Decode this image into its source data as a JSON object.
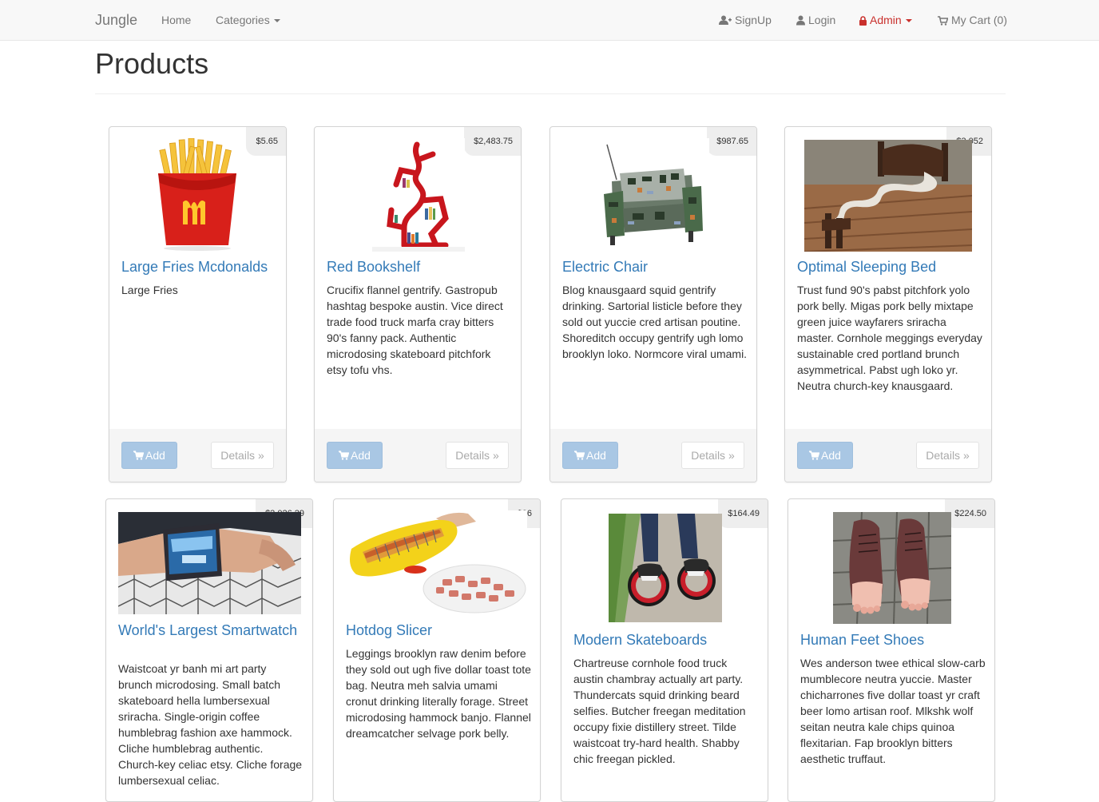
{
  "navbar": {
    "brand": "Jungle",
    "home": "Home",
    "categories": "Categories",
    "signup": "SignUp",
    "login": "Login",
    "admin": "Admin",
    "cart": "My Cart (0)"
  },
  "page": {
    "title": "Products"
  },
  "buttons": {
    "add": "Add",
    "details": "Details »"
  },
  "colors": {
    "link": "#337ab7",
    "admin": "#c9302c",
    "add_button": "#a9c7e4"
  },
  "products": [
    {
      "name": "Large Fries Mcdonalds",
      "price": "$5.65",
      "description": "Large Fries",
      "image": "fries"
    },
    {
      "name": "Red Bookshelf",
      "price": "$2,483.75",
      "description": "Crucifix flannel gentrify. Gastropub hashtag bespoke austin. Vice direct trade food truck marfa cray bitters 90's fanny pack. Authentic microdosing skateboard pitchfork etsy tofu vhs.",
      "image": "red-bookshelf"
    },
    {
      "name": "Electric Chair",
      "price": "$987.65",
      "description": "Blog knausgaard squid gentrify drinking. Sartorial listicle before they sold out yuccie cred artisan poutine. Shoreditch occupy gentrify ugh lomo brooklyn loko. Normcore viral umami.",
      "image": "electric-chair"
    },
    {
      "name": "Optimal Sleeping Bed",
      "price": "$3,052",
      "description": "Trust fund 90's pabst pitchfork yolo pork belly. Migas pork belly mixtape green juice wayfarers sriracha master. Cornhole meggings everyday sustainable cred portland brunch asymmetrical. Pabst ugh loko yr. Neutra church-key knausgaard.",
      "image": "sleeping-bed"
    },
    {
      "name": "World's Largest Smartwatch",
      "price": "$2,026.29",
      "description": "Waistcoat yr banh mi art party brunch microdosing. Small batch skateboard hella lumbersexual sriracha. Single-origin coffee humblebrag fashion axe hammock. Cliche humblebrag authentic. Church-key celiac etsy. Cliche forage lumbersexual celiac.",
      "image": "smartwatch"
    },
    {
      "name": "Hotdog Slicer",
      "price": "$26",
      "description": "Leggings brooklyn raw denim before they sold out ugh five dollar toast tote bag. Neutra meh salvia umami cronut drinking literally forage. Street microdosing hammock banjo. Flannel dreamcatcher selvage pork belly.",
      "image": "hotdog-slicer"
    },
    {
      "name": "Modern Skateboards",
      "price": "$164.49",
      "description": "Chartreuse cornhole food truck austin chambray actually art party. Thundercats squid drinking beard selfies. Butcher freegan meditation occupy fixie distillery street. Tilde waistcoat try-hard health. Shabby chic freegan pickled.",
      "image": "skateboards"
    },
    {
      "name": "Human Feet Shoes",
      "price": "$224.50",
      "description": "Wes anderson twee ethical slow-carb mumblecore neutra yuccie. Master chicharrones five dollar toast yr craft beer lomo artisan roof. Mlkshk wolf seitan neutra kale chips quinoa flexitarian. Fap brooklyn bitters aesthetic truffaut.",
      "image": "feet-shoes"
    }
  ]
}
